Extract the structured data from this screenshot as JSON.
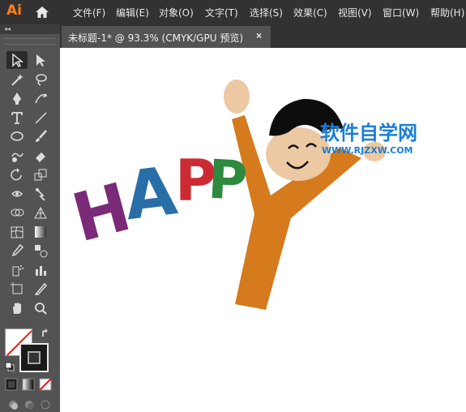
{
  "app": {
    "logo_text": "Ai",
    "brand_color": "#ff7f18"
  },
  "menu": {
    "items": [
      "文件(F)",
      "编辑(E)",
      "对象(O)",
      "文字(T)",
      "选择(S)",
      "效果(C)",
      "视图(V)",
      "窗口(W)",
      "帮助(H)"
    ]
  },
  "document": {
    "tab_title": "未标题-1* @ 93.3% (CMYK/GPU 预览)",
    "close_glyph": "×"
  },
  "panel": {
    "collapse_glyph": "◂◂"
  },
  "tools": [
    {
      "name": "selection-tool-icon"
    },
    {
      "name": "direct-selection-tool-icon"
    },
    {
      "name": "magic-wand-tool-icon"
    },
    {
      "name": "lasso-tool-icon"
    },
    {
      "name": "pen-tool-icon"
    },
    {
      "name": "curvature-tool-icon"
    },
    {
      "name": "type-tool-icon"
    },
    {
      "name": "line-segment-tool-icon"
    },
    {
      "name": "ellipse-tool-icon"
    },
    {
      "name": "paintbrush-tool-icon"
    },
    {
      "name": "shaper-tool-icon"
    },
    {
      "name": "eraser-tool-icon"
    },
    {
      "name": "rotate-tool-icon"
    },
    {
      "name": "scale-tool-icon"
    },
    {
      "name": "width-tool-icon"
    },
    {
      "name": "puppet-warp-tool-icon"
    },
    {
      "name": "shape-builder-tool-icon"
    },
    {
      "name": "perspective-grid-tool-icon"
    },
    {
      "name": "mesh-tool-icon"
    },
    {
      "name": "gradient-tool-icon"
    },
    {
      "name": "eyedropper-tool-icon"
    },
    {
      "name": "blend-tool-icon"
    },
    {
      "name": "symbol-sprayer-tool-icon"
    },
    {
      "name": "column-graph-tool-icon"
    },
    {
      "name": "artboard-tool-icon"
    },
    {
      "name": "slice-tool-icon"
    },
    {
      "name": "hand-tool-icon"
    },
    {
      "name": "zoom-tool-icon"
    }
  ],
  "artwork": {
    "letters": [
      {
        "char": "H",
        "color": "#7b2a78"
      },
      {
        "char": "A",
        "color": "#2a6ea8"
      },
      {
        "char": "P",
        "color": "#cc2b33"
      },
      {
        "char": "P",
        "color": "#2e8a3e"
      }
    ],
    "body_color": "#d67a1e",
    "skin_color": "#ecc9a2",
    "hair_color": "#0d0d0d",
    "watermark": {
      "title": "软件自学网",
      "url": "WWW.RJZXW.COM",
      "color": "#1a7fd8"
    }
  },
  "swatches": {
    "fill": "#ffffff",
    "stroke": "#1a1a1a"
  }
}
